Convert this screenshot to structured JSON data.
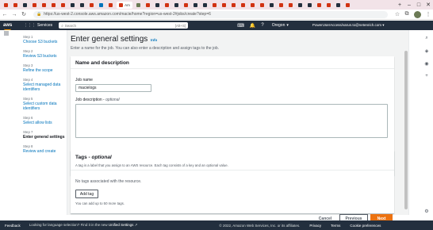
{
  "browser": {
    "url": "https://us-west-2.console.aws.amazon.com/macie/home?region=us-west-2#jobs/create?step=6",
    "tab_favicon_colors": [
      "#d13212",
      "#d13212",
      "#232f3e",
      "#d13212",
      "#d13212",
      "#d13212",
      "#d13212",
      "#232f3e",
      "#232f3e",
      "#d13212",
      "#0073bb",
      "#d13212",
      "#d13212",
      "#6b7a55",
      "#d13212",
      "#232f3e",
      "#d13212",
      "#232f3e",
      "#d13212",
      "#232f3e",
      "#232f3e",
      "#d13212",
      "#d13212",
      "#d13212",
      "#d13212",
      "#d13212",
      "#d13212",
      "#232f3e",
      "#d13212",
      "#d13212",
      "#232f3e",
      "#232f3e",
      "#d13212",
      "#d13212",
      "#232f3e",
      "#d13212"
    ],
    "active_tab_index": 12,
    "active_tab_label": "Am"
  },
  "aws_nav": {
    "logo_text": "aws",
    "services_label": "Services",
    "search_placeholder": "Search",
    "search_shortcut": "[Alt+S]",
    "region_label": "Oregon",
    "account_label": "PowerUserAccess/varun.to@netenrich.com"
  },
  "steps": [
    {
      "num": "Step 1",
      "label": "Choose S3 buckets",
      "state": "link"
    },
    {
      "num": "Step 2",
      "label": "Review S3 buckets",
      "state": "link"
    },
    {
      "num": "Step 3",
      "label": "Refine the scope",
      "state": "link"
    },
    {
      "num": "Step 4",
      "label": "Select managed data identifiers",
      "state": "link"
    },
    {
      "num": "Step 5",
      "label": "Select custom data identifiers",
      "state": "link"
    },
    {
      "num": "Step 6",
      "label": "Select allow lists",
      "state": "link"
    },
    {
      "num": "Step 7",
      "label": "Enter general settings",
      "state": "current"
    },
    {
      "num": "Step 8",
      "label": "Review and create",
      "state": "link"
    }
  ],
  "page": {
    "title": "Enter general settings",
    "info_link": "Info",
    "description": "Enter a name for the job. You can also enter a description and assign tags to the job."
  },
  "name_section": {
    "title": "Name and description",
    "job_name_label": "Job name",
    "job_name_value": "macielogs",
    "job_desc_label": "Job description - ",
    "job_desc_optional": "optional",
    "job_desc_value": ""
  },
  "tags_section": {
    "title": "Tags - ",
    "title_optional": "optional",
    "description": "A tag is a label that you assign to an AWS resource. Each tag consists of a key and an optional value.",
    "empty_text": "No tags associated with the resource.",
    "add_button": "Add tag",
    "limit_text": "You can add up to 50 more tags."
  },
  "actions": {
    "cancel": "Cancel",
    "previous": "Previous",
    "next": "Next"
  },
  "footer": {
    "feedback": "Feedback",
    "language_prefix": "Looking for language selection? Find it in the new ",
    "language_link": "Unified Settings",
    "copyright": "© 2022, Amazon Web Services, Inc. or its affiliates.",
    "privacy": "Privacy",
    "terms": "Terms",
    "cookies": "Cookie preferences"
  },
  "colors": {
    "aws_dark": "#232f3e",
    "primary_orange": "#ec7211",
    "link_blue": "#0073bb",
    "page_bg": "#f2f3f3"
  }
}
